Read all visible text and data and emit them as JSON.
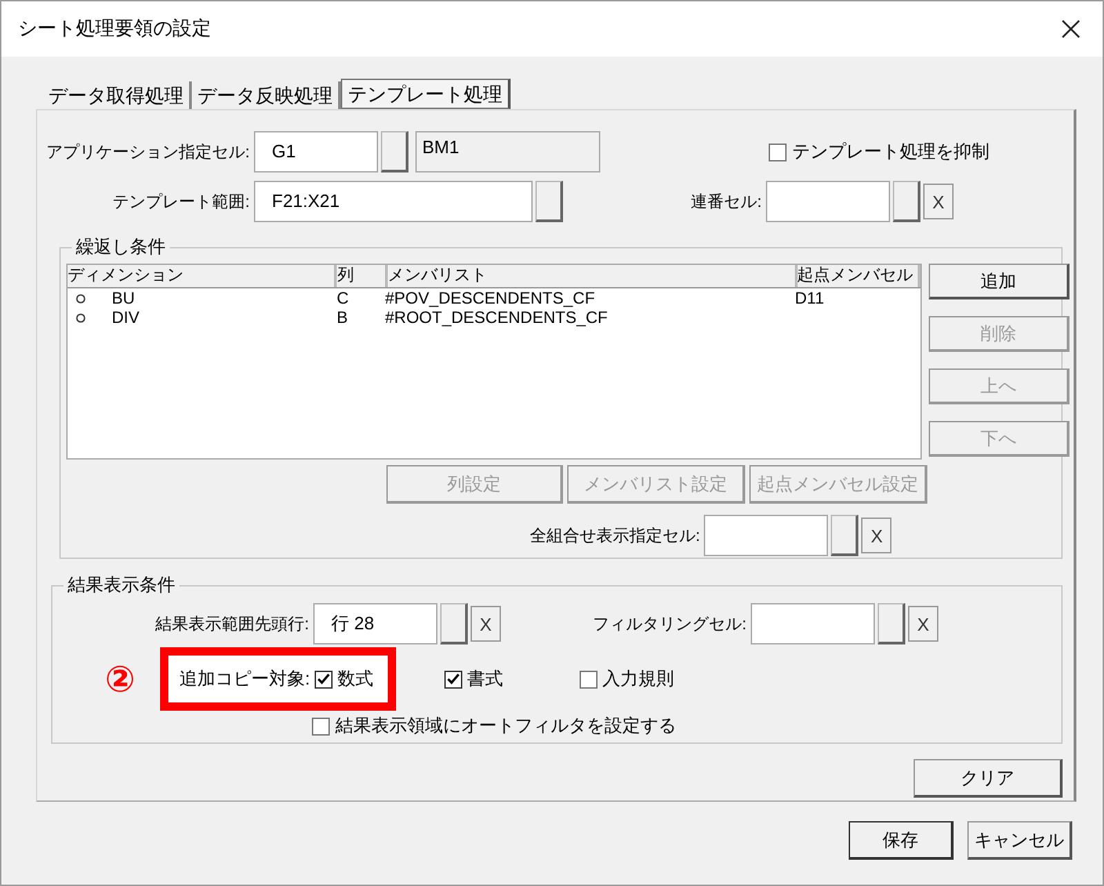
{
  "window": {
    "title": "シート処理要領の設定"
  },
  "tabs": [
    {
      "label": "データ取得処理",
      "selected": false
    },
    {
      "label": "データ反映処理",
      "selected": false
    },
    {
      "label": "テンプレート処理",
      "selected": true
    }
  ],
  "app_cell": {
    "label": "アプリケーション指定セル:",
    "value": "G1",
    "ref_value": "BM1"
  },
  "suppress": {
    "label": "テンプレート処理を抑制",
    "checked": false
  },
  "template_range": {
    "label": "テンプレート範囲:",
    "value": "F21:X21"
  },
  "serial_cell": {
    "label": "連番セル:",
    "clear": "X"
  },
  "repeat_group": {
    "title": "繰返し条件",
    "columns": [
      "ディメンション",
      "列",
      "メンバリスト",
      "起点メンバセル"
    ],
    "rows": [
      {
        "dimension": "BU",
        "column": "C",
        "member_list": "#POV_DESCENDENTS_CF",
        "start_cell": "D11"
      },
      {
        "dimension": "DIV",
        "column": "B",
        "member_list": "#ROOT_DESCENDENTS_CF"
      }
    ],
    "side_buttons": [
      {
        "label": "追加",
        "disabled": false
      },
      {
        "label": "削除",
        "disabled": true
      },
      {
        "label": "上へ",
        "disabled": true
      },
      {
        "label": "下へ",
        "disabled": true
      }
    ],
    "bottom_buttons": [
      {
        "label": "列設定",
        "disabled": true
      },
      {
        "label": "メンバリスト設定",
        "disabled": true
      },
      {
        "label": "起点メンバセル設定",
        "disabled": true
      }
    ],
    "all_combo": {
      "label": "全組合せ表示指定セル:",
      "clear": "X"
    }
  },
  "result_group": {
    "title": "結果表示条件",
    "first_row": {
      "label": "結果表示範囲先頭行:",
      "value": "行 28",
      "clear": "X"
    },
    "filter_cell": {
      "label": "フィルタリングセル:",
      "clear": "X"
    },
    "copy_targets": {
      "label": "追加コピー対象:",
      "marker": "②",
      "options": [
        {
          "label": "数式",
          "checked": true
        },
        {
          "label": "書式",
          "checked": true
        },
        {
          "label": "入力規則",
          "checked": false
        }
      ]
    },
    "autofilter": {
      "label": "結果表示領域にオートフィルタを設定する",
      "checked": false
    }
  },
  "clear_button": "クリア",
  "footer_buttons": [
    "保存",
    "キャンセル"
  ]
}
